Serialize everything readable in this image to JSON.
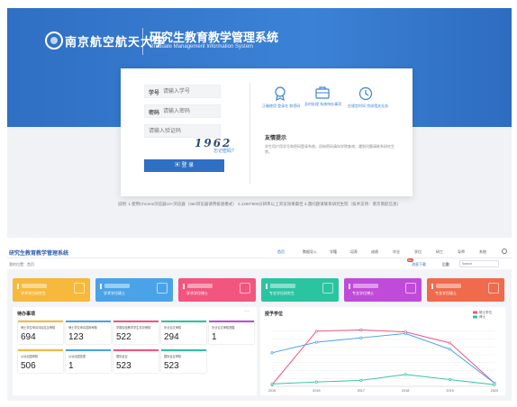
{
  "login": {
    "university": "南京航空航天大学",
    "system_title": "研究生教育教学管理系统",
    "system_title_en": "Graduate Management Information System",
    "student_id_label": "学号",
    "student_id_placeholder": "请输入学号",
    "password_label": "密码",
    "password_placeholder": "请输入密码",
    "captcha_placeholder": "请输入验证码",
    "captcha": "1962",
    "forgot": "忘记密码?",
    "login_button": "登 录",
    "features": [
      {
        "label": "正确使用 登录名 和密码",
        "icon": "award-icon"
      },
      {
        "label": "及时处理 系统待办事项",
        "icon": "briefcase-icon"
      },
      {
        "label": "在规定时间 完成相关业务",
        "icon": "clock-icon"
      }
    ],
    "notice_title": "友情提示",
    "notice_text": "学生用户用学号和密码登录系统，初始密码请向学院查询；遇到问题请联系研究生院。",
    "footer": "说明: 1.使用Chrome浏览器10+浏览器（360浏览器请用极速模式）  2.1280*800分辨率以上浏览效果最佳  3.遇问题请联系研究生院（技术支持：南京南航信息）"
  },
  "dashboard": {
    "app_title": "研究生教育教学管理系统",
    "menu": [
      {
        "label": "首页",
        "active": true
      },
      {
        "label": "数据导入",
        "active": false
      },
      {
        "label": "学籍",
        "active": false
      },
      {
        "label": "培养",
        "active": false
      },
      {
        "label": "成绩",
        "active": false
      },
      {
        "label": "毕业",
        "active": false
      },
      {
        "label": "学位",
        "active": false
      },
      {
        "label": "研工",
        "active": false
      },
      {
        "label": "导师",
        "active": false
      },
      {
        "label": "系统",
        "active": false
      }
    ],
    "breadcrumb": "我的位置：首页",
    "notifications_label": "消息下载",
    "notifications_badge": "99+",
    "user_label": "后勤",
    "search_placeholder": "Search",
    "tiles": [
      {
        "label": "学术学位研究生",
        "color": "#f6b93b"
      },
      {
        "label": "学术学位硕士",
        "color": "#4aa3e8"
      },
      {
        "label": "学术学位博士",
        "color": "#f2557e"
      },
      {
        "label": "专业学位研究生",
        "color": "#2bc4a1"
      },
      {
        "label": "专业学位博士",
        "color": "#c04bd8"
      },
      {
        "label": "专业学位硕士",
        "color": "#f06a4c"
      }
    ],
    "todo_title": "待办事项",
    "todo_more": "···",
    "todo_items": [
      {
        "label": "博士学位申请评阅意见审核",
        "value": "694",
        "color": "#f6b93b"
      },
      {
        "label": "博士学位申请答辩审核",
        "value": "123",
        "color": "#4aa3e8"
      },
      {
        "label": "学期实验教学学生情况审核",
        "value": "522",
        "color": "#f2557e"
      },
      {
        "label": "毕业论文审核",
        "value": "294",
        "color": "#2bc4a1"
      },
      {
        "label": "毕业论文审核提醒",
        "value": "1",
        "color": "#c04bd8"
      },
      {
        "label": "公派出国审核",
        "value": "506",
        "color": "#f6b93b"
      },
      {
        "label": "公派出国变更",
        "value": "1",
        "color": "#4aa3e8"
      },
      {
        "label": "国际会议",
        "value": "523",
        "color": "#f2557e"
      },
      {
        "label": "国际会议审核",
        "value": "523",
        "color": "#2bc4a1"
      }
    ],
    "chart_title": "授予学位",
    "chart_colors": [
      "#f2557e",
      "#4aa3e8",
      "#2bc4a1"
    ]
  },
  "chart_data": {
    "type": "line",
    "title": "授予学位",
    "x": [
      "2015",
      "2016",
      "2017",
      "2018",
      "2019",
      "2020"
    ],
    "series": [
      {
        "name": "硕士学位",
        "values": [
          40,
          1400,
          1430,
          1380,
          1100,
          80
        ]
      },
      {
        "name": "",
        "values": [
          850,
          1120,
          1230,
          1340,
          940,
          80
        ]
      },
      {
        "name": "博士",
        "values": [
          60,
          110,
          150,
          300,
          170,
          40
        ]
      }
    ],
    "ylim": [
      0,
      1600
    ],
    "yticks": [
      0,
      200,
      400,
      600,
      800,
      1000,
      1200,
      1400
    ],
    "grid": true,
    "legend": "top-right"
  }
}
